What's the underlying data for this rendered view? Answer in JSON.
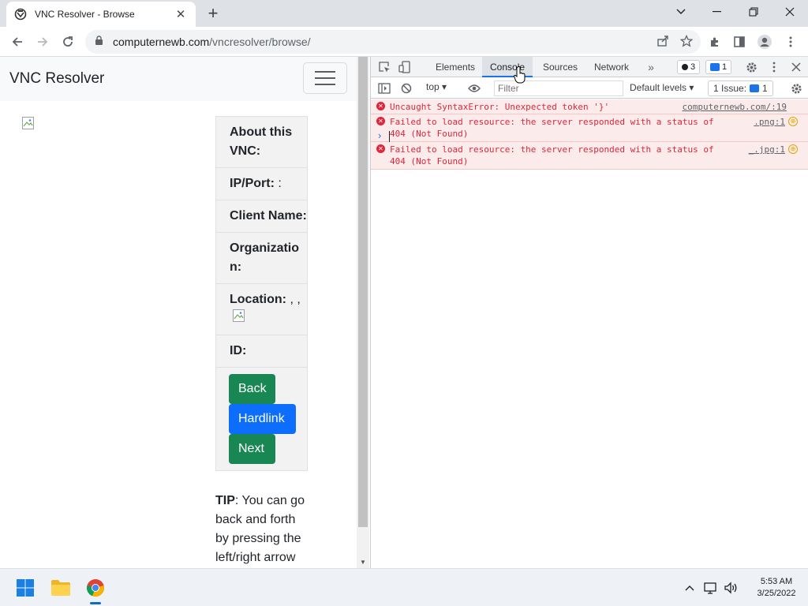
{
  "browser": {
    "tab_title": "VNC Resolver - Browse",
    "url_host": "computernewb.com",
    "url_path": "/vncresolver/browse/"
  },
  "page": {
    "brand": "VNC Resolver",
    "info": [
      {
        "label": "About this VNC:",
        "value": ""
      },
      {
        "label": "IP/Port:",
        "value": " :"
      },
      {
        "label": "Client Name:",
        "value": ""
      },
      {
        "label": "Organization:",
        "value": ""
      },
      {
        "label": "Location:",
        "value": " , ,"
      },
      {
        "label": "ID:",
        "value": ""
      }
    ],
    "buttons": {
      "back": "Back",
      "hardlink": "Hardlink",
      "next": "Next"
    },
    "tip_label": "TIP",
    "tip_text": ": You can go back and forth by pressing the left/right arrow"
  },
  "devtools": {
    "tabs": [
      "Elements",
      "Console",
      "Sources",
      "Network"
    ],
    "active_tab": "Console",
    "error_count": "3",
    "message_count": "1",
    "context": "top",
    "filter_placeholder": "Filter",
    "levels": "Default levels",
    "issues": "1 Issue:",
    "issues_count": "1",
    "messages": [
      {
        "text": "Uncaught SyntaxError: Unexpected token '}'",
        "source": "computernewb.com/:19"
      },
      {
        "text": "Failed to load resource: the server responded with a status of 404 (Not Found)",
        "source": ".png:1"
      },
      {
        "text": "Failed to load resource: the server responded with a status of 404 (Not Found)",
        "source": "_.jpg:1"
      }
    ]
  },
  "taskbar": {
    "time": "5:53 AM",
    "date": "3/25/2022"
  },
  "colors": {
    "success": "#198754",
    "primary": "#0d6efd",
    "error": "#e0263a",
    "devtools_accent": "#1a73e8"
  }
}
